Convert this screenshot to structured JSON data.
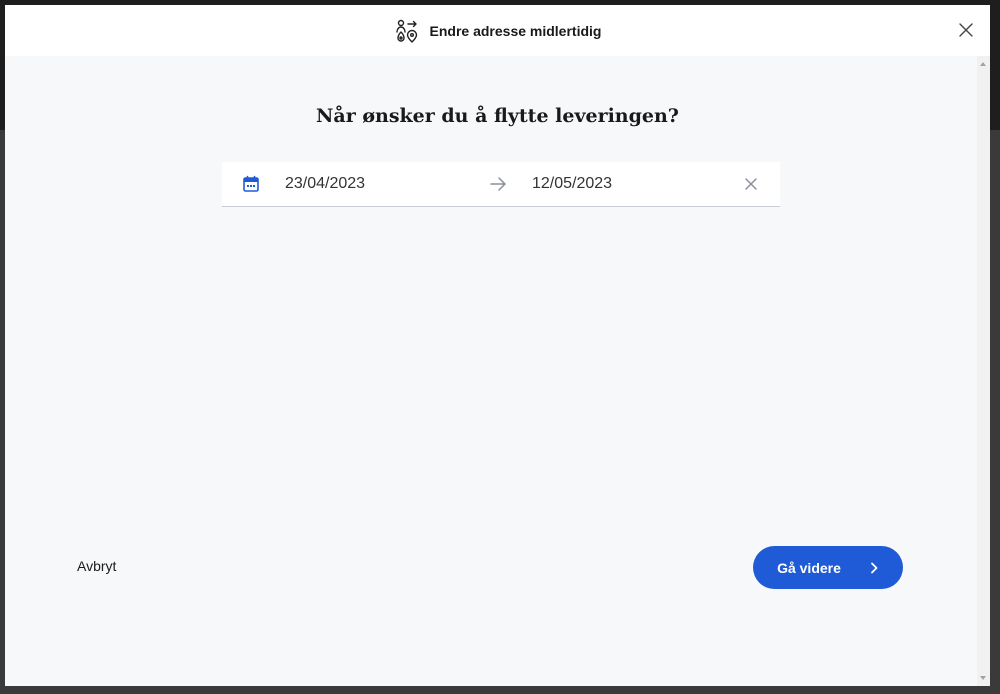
{
  "header": {
    "title": "Endre adresse midlertidig",
    "icon": "move-location-icon",
    "close_icon": "close-icon"
  },
  "main": {
    "question": "Når ønsker du å flytte leveringen?",
    "date_range": {
      "icon": "calendar-icon",
      "start": "23/04/2023",
      "end": "12/05/2023",
      "separator_icon": "arrow-right-icon",
      "clear_icon": "clear-icon"
    }
  },
  "footer": {
    "cancel_label": "Avbryt",
    "continue_label": "Gå videre",
    "continue_icon": "chevron-right-icon"
  },
  "colors": {
    "accent": "#1f5bd6",
    "modal_background": "#f7f8fa",
    "header_background": "#ffffff"
  }
}
